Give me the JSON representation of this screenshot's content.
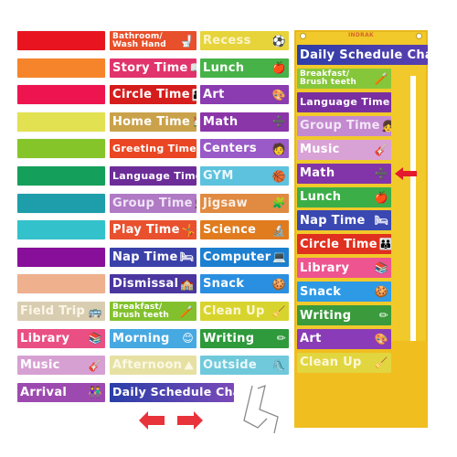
{
  "color_strips": [
    {
      "color": "#e8141f"
    },
    {
      "color": "#f6842a"
    },
    {
      "color": "#ee1450"
    },
    {
      "color": "#e2e152"
    },
    {
      "color": "#86c52a"
    },
    {
      "color": "#14a05a"
    },
    {
      "color": "#1e9daa"
    },
    {
      "color": "#33c2cc"
    },
    {
      "color": "#880f9a"
    },
    {
      "color": "#efb08e"
    }
  ],
  "column1_cards": [
    {
      "label": "Field Trip",
      "icon": "🚌",
      "bg": "#d8cdb0",
      "fg": "#fbf6e8"
    },
    {
      "label": "Library",
      "icon": "📚",
      "bg": "#ea4f84",
      "fg": "#ffffff"
    },
    {
      "label": "Music",
      "icon": "🎸",
      "bg": "#d7a0d2",
      "fg": "#ffffff"
    },
    {
      "label": "Arrival",
      "icon": "👫",
      "bg": "#9d4ab0",
      "fg": "#ffffff"
    }
  ],
  "column2_cards": [
    {
      "label": "Bathroom/\nWash Hand",
      "icon": "🚽",
      "bg": "#e7502b",
      "fg": "#ffffff",
      "two_line": true
    },
    {
      "label": "Story Time",
      "icon": "📖",
      "bg": "#e1336c",
      "fg": "#ffffff"
    },
    {
      "label": "Circle Time",
      "icon": "👪",
      "bg": "#d61d1d",
      "fg": "#ffffff"
    },
    {
      "label": "Home Time",
      "icon": "🏠",
      "bg": "#caa24c",
      "fg": "#ffffff"
    },
    {
      "label": "Greeting Time",
      "icon": "👋",
      "bg": "#ea4623",
      "fg": "#ffffff",
      "small": true
    },
    {
      "label": "Language Time",
      "icon": "🧒",
      "bg": "#6c2d98",
      "fg": "#ffffff",
      "small": true
    },
    {
      "label": "Group Time",
      "icon": "👧",
      "bg": "#b07ac5",
      "fg": "#efe3f5"
    },
    {
      "label": "Play Time",
      "icon": "🤸",
      "bg": "#e8502e",
      "fg": "#ffffff"
    },
    {
      "label": "Nap Time",
      "icon": "🛏",
      "bg": "#3a41a8",
      "fg": "#ffffff"
    },
    {
      "label": "Dismissal",
      "icon": "🏫",
      "bg": "#4b36a0",
      "fg": "#ffffff"
    },
    {
      "label": "Breakfast/\nBrush teeth",
      "icon": "🪥",
      "bg": "#82c12d",
      "fg": "#ffffff",
      "two_line": true
    },
    {
      "label": "Morning",
      "icon": "😊",
      "bg": "#47a9e2",
      "fg": "#ffffff"
    },
    {
      "label": "Afternoon",
      "icon": "⛰",
      "bg": "#e6e1a3",
      "fg": "#fbf8e3"
    },
    {
      "label": "Daily Schedule Chart",
      "icon": "",
      "bg": "#2a3ea8",
      "fg": "#ffffff",
      "wide": true
    }
  ],
  "column3_cards": [
    {
      "label": "Recess",
      "icon": "⚽",
      "bg": "#e6d43a",
      "fg": "#fbf4c8"
    },
    {
      "label": "Lunch",
      "icon": "🍎",
      "bg": "#47b248",
      "fg": "#ffffff"
    },
    {
      "label": "Art",
      "icon": "🎨",
      "bg": "#8a3cb0",
      "fg": "#ffffff"
    },
    {
      "label": "Math",
      "icon": "➗",
      "bg": "#8a35a8",
      "fg": "#ffffff"
    },
    {
      "label": "Centers",
      "icon": "🧑",
      "bg": "#9a5ac8",
      "fg": "#ffffff"
    },
    {
      "label": "GYM",
      "icon": "🏀",
      "bg": "#5cc2dd",
      "fg": "#eaf8fc"
    },
    {
      "label": "Jigsaw",
      "icon": "🧩",
      "bg": "#e08a42",
      "fg": "#fbefe3"
    },
    {
      "label": "Science",
      "icon": "🔬",
      "bg": "#e07b1e",
      "fg": "#ffffff"
    },
    {
      "label": "Computer",
      "icon": "💻",
      "bg": "#1c7fd0",
      "fg": "#ffffff"
    },
    {
      "label": "Snack",
      "icon": "🍪",
      "bg": "#2a8fe0",
      "fg": "#ffffff"
    },
    {
      "label": "Clean Up",
      "icon": "🧹",
      "bg": "#d8d42e",
      "fg": "#fbf8d4"
    },
    {
      "label": "Writing",
      "icon": "✏",
      "bg": "#2f9a3c",
      "fg": "#ffffff"
    },
    {
      "label": "Outside",
      "icon": "🛝",
      "bg": "#6fc9db",
      "fg": "#eaf8fb"
    }
  ],
  "pocket_chart": {
    "brand": "INDRAK",
    "header": {
      "label": "Daily Schedule Chart",
      "bg": "#2e3ea8",
      "fg": "#ffffff"
    },
    "items": [
      {
        "label": "Breakfast/\nBrush teeth",
        "icon": "🪥",
        "bg": "#86c63a",
        "fg": "#ffffff",
        "two_line": true
      },
      {
        "label": "Language Time",
        "icon": "🧒",
        "bg": "#7a2fa0",
        "fg": "#ffffff",
        "small": true
      },
      {
        "label": "Group Time",
        "icon": "👧",
        "bg": "#c48ad0",
        "fg": "#f2e6f6"
      },
      {
        "label": "Music",
        "icon": "🎸",
        "bg": "#d9a2d6",
        "fg": "#ffffff"
      },
      {
        "label": "Math",
        "icon": "➗",
        "bg": "#8235a8",
        "fg": "#ffffff"
      },
      {
        "label": "Lunch",
        "icon": "🍎",
        "bg": "#3cae48",
        "fg": "#ffffff"
      },
      {
        "label": "Nap Time",
        "icon": "🛏",
        "bg": "#3a48b2",
        "fg": "#ffffff"
      },
      {
        "label": "Circle Time",
        "icon": "👪",
        "bg": "#e0301f",
        "fg": "#ffffff"
      },
      {
        "label": "Library",
        "icon": "📚",
        "bg": "#ee5590",
        "fg": "#ffffff"
      },
      {
        "label": "Snack",
        "icon": "🍪",
        "bg": "#2e9ae6",
        "fg": "#ffffff"
      },
      {
        "label": "Writing",
        "icon": "✏",
        "bg": "#3a9a3c",
        "fg": "#ffffff"
      },
      {
        "label": "Art",
        "icon": "🎨",
        "bg": "#8a3cb8",
        "fg": "#ffffff"
      },
      {
        "label": "Clean Up",
        "icon": "🧹",
        "bg": "#e2d640",
        "fg": "#fbf8d8"
      }
    ],
    "current_item_index": 4,
    "pointer_color": "#e3192d"
  },
  "accessories": {
    "arrow_color": "#e8333b",
    "hooks_color": "#8a8a8a"
  }
}
